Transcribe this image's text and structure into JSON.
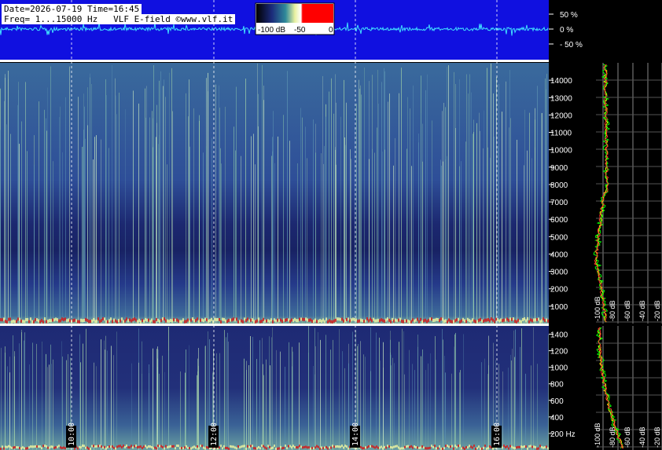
{
  "header": {
    "line1": "Date=2026-07-19 Time=16:45",
    "line2": "Freq= 1...15000 Hz   VLF E-field ©www.vlf.it"
  },
  "colorbar": {
    "labels": [
      "-100 dB",
      "-50",
      "0"
    ],
    "colors": [
      "#000000",
      "#1b2a7a",
      "#2f8a9a",
      "#e8f0a0",
      "#ffffff",
      "#ff0000",
      "#ff0000"
    ]
  },
  "waveform": {
    "labels": [
      "50 %",
      "0 %",
      "- 50 %"
    ],
    "background": "#1010e0",
    "trace_color": "#40e0ff"
  },
  "time_axis": {
    "labels": [
      "10:00",
      "12:00",
      "14:00",
      "16:00"
    ]
  },
  "chart_data": [
    {
      "type": "heatmap",
      "title": "",
      "panel": "spectrogram-main",
      "xlabel": "",
      "ylabel": "",
      "x_ticks": [
        "10:00",
        "12:00",
        "14:00",
        "16:00"
      ],
      "yticks": [
        1000,
        2000,
        3000,
        4000,
        5000,
        6000,
        7000,
        8000,
        9000,
        10000,
        11000,
        12000,
        13000,
        14000
      ],
      "ylim": [
        0,
        15000
      ],
      "grid": true
    },
    {
      "type": "heatmap",
      "title": "",
      "panel": "spectrogram-zoom",
      "x_ticks": [
        "10:00",
        "12:00",
        "14:00",
        "16:00"
      ],
      "yticks": [
        200,
        400,
        600,
        800,
        1000,
        1200,
        1400
      ],
      "y_tick_labels": [
        "200 Hz",
        "400",
        "600",
        "800",
        "1000",
        "1200",
        "1400"
      ],
      "ylim": [
        0,
        1500
      ],
      "grid": true
    },
    {
      "type": "line",
      "panel": "spectrum-main",
      "x_tick_labels": [
        "-100 dB",
        "-80 dB",
        "-60 dB",
        "-40 dB",
        "-20 dB"
      ],
      "series": [
        {
          "color": "#ffff00"
        },
        {
          "color": "#00ff00"
        },
        {
          "color": "#ff3030"
        }
      ]
    },
    {
      "type": "line",
      "panel": "spectrum-zoom",
      "x_tick_labels": [
        "-100 dB",
        "-80 dB",
        "-60 dB",
        "-40 dB",
        "-20 dB"
      ],
      "series": [
        {
          "color": "#ffff00"
        },
        {
          "color": "#00ff00"
        },
        {
          "color": "#ff3030"
        }
      ]
    }
  ]
}
